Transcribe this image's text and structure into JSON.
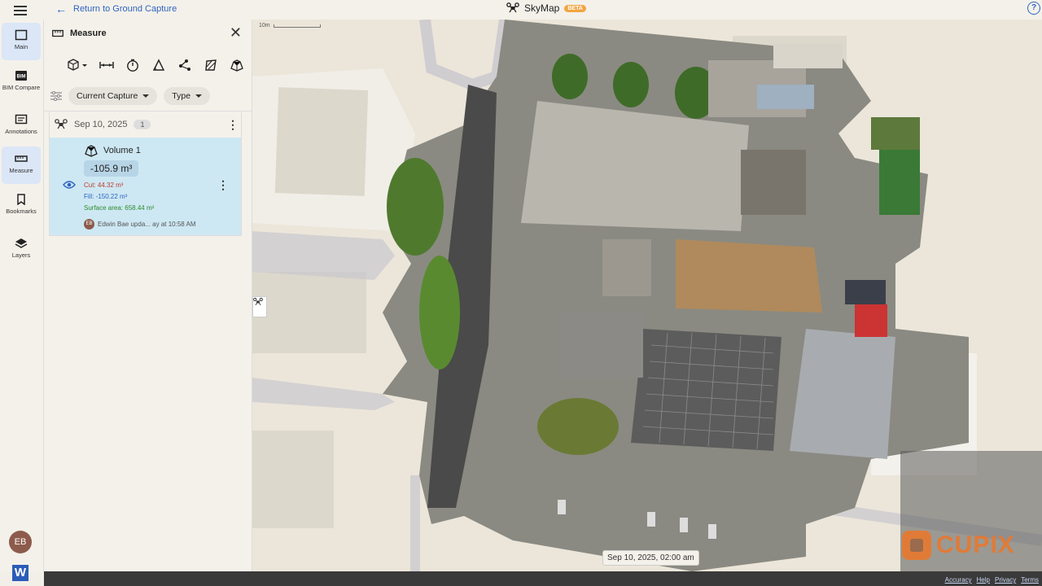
{
  "topbar": {
    "back_label": "Return to Ground Capture",
    "brand": "SkyMap",
    "badge": "BETA",
    "help": "?"
  },
  "rail": {
    "items": [
      {
        "label": "Main",
        "icon": "square-icon"
      },
      {
        "label": "BIM Compare",
        "icon": "bim-icon"
      },
      {
        "label": "Annotations",
        "icon": "annotation-icon"
      },
      {
        "label": "Measure",
        "icon": "ruler-icon"
      },
      {
        "label": "Bookmarks",
        "icon": "bookmark-icon"
      },
      {
        "label": "Layers",
        "icon": "layers-icon"
      }
    ],
    "avatar": "EB",
    "app_logo": "W"
  },
  "panel": {
    "title": "Measure",
    "tools": [
      "volume-tool-icon",
      "distance-tool-icon",
      "timer-tool-icon",
      "angle-tool-icon",
      "path-tool-icon",
      "area-tool-icon",
      "volume-shape-tool-icon"
    ],
    "filters": {
      "capture": "Current Capture",
      "type": "Type"
    },
    "group": {
      "date": "Sep 10, 2025",
      "count": "1"
    },
    "item": {
      "title": "Volume 1",
      "value": "-105.9 m³",
      "cut": "Cut: 44.32 m³",
      "fill": "Fill: -150.22 m³",
      "surface": "Surface area: 658.44 m²",
      "updater_initials": "EB",
      "updater_text": "Edwin Bae upda... ay at 10:58 AM"
    }
  },
  "map": {
    "scale": "10m",
    "timestamp": "Sep 10, 2025, 02:00 am",
    "watermark": "CUPIX"
  },
  "footer": {
    "links": [
      "Accuracy",
      "Help",
      "Privacy",
      "Terms"
    ]
  },
  "colors": {
    "accent": "#2f64c2",
    "beta": "#f2a540",
    "card": "#cde8f3",
    "cut": "#c0392b",
    "fill": "#2f64c2",
    "surface": "#2e8b2e"
  }
}
